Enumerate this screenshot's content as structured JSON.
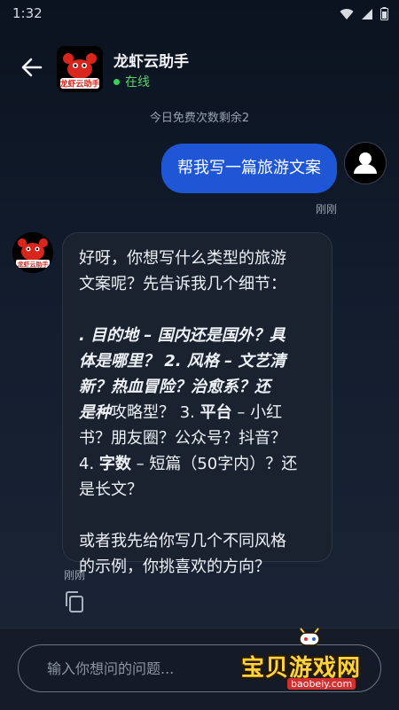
{
  "status": {
    "time": "1:32"
  },
  "header": {
    "app_name": "龙虾云助手",
    "status": "在线",
    "logo_text": "龙虾云助手"
  },
  "quota": "今日免费次数剩余2",
  "messages": {
    "user": {
      "text": "帮我写一篇旅游文案",
      "time": "刚刚"
    },
    "bot": {
      "intro_1": "好呀，你想写什么类型的旅游",
      "intro_2": "文案呢？先告诉我几个细节：",
      "l1": ". 目的地 – 国内还是国外？具",
      "l2": "体是哪里？ 2. 风格 – 文艺清",
      "l3": "新？热血冒险？治愈系？还",
      "l4a": "是种",
      "l4b": "攻略型？ 3. ",
      "l4c": "平台",
      "l4d": " – 小红",
      "l5": "书？朋友圈？公众号？抖音？",
      "l6a": "4. ",
      "l6b": "字数",
      "l6c": " – 短篇（50字内）？还",
      "l7": "是长文？",
      "outro_1": "或者我先给你写几个不同风格",
      "outro_2": "的示例，你挑喜欢的方向？",
      "time": "刚刚"
    }
  },
  "input": {
    "placeholder": "输入你想问的问题..."
  },
  "watermark": {
    "text": "宝贝游戏网",
    "url": "baobeiy.com"
  },
  "colors": {
    "accent": "#1f56d6",
    "online": "#3ecf5a",
    "background": "#0b1320"
  }
}
